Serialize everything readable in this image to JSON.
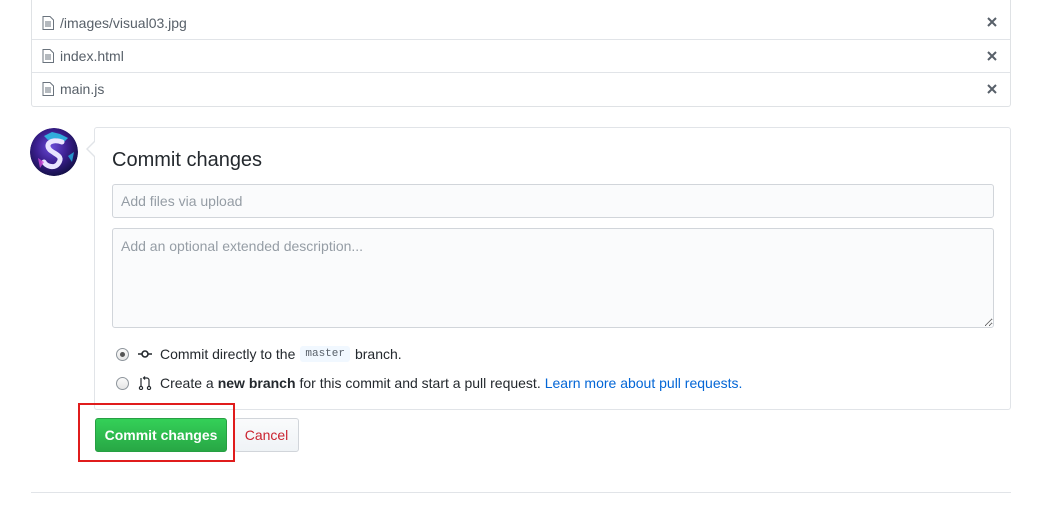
{
  "files": [
    {
      "name": "/images/visual03.jpg"
    },
    {
      "name": "index.html"
    },
    {
      "name": "main.js"
    }
  ],
  "commit": {
    "title": "Commit changes",
    "summary_placeholder": "Add files via upload",
    "description_placeholder": "Add an optional extended description...",
    "option_direct": {
      "prefix": "Commit directly to the",
      "branch": "master",
      "suffix": "branch."
    },
    "option_new": {
      "prefix": "Create a",
      "bold": "new branch",
      "middle": "for this commit and start a pull request.",
      "link": "Learn more about pull requests."
    },
    "selected_option": "direct"
  },
  "buttons": {
    "commit_label": "Commit changes",
    "cancel_label": "Cancel"
  },
  "colors": {
    "primary_green": "#28a745",
    "cancel_red": "#cb2431",
    "link_blue": "#0366d6",
    "highlight_red": "#e01c1c"
  },
  "icons": [
    "file-icon",
    "close-icon",
    "git-commit-icon",
    "git-pull-request-icon"
  ]
}
